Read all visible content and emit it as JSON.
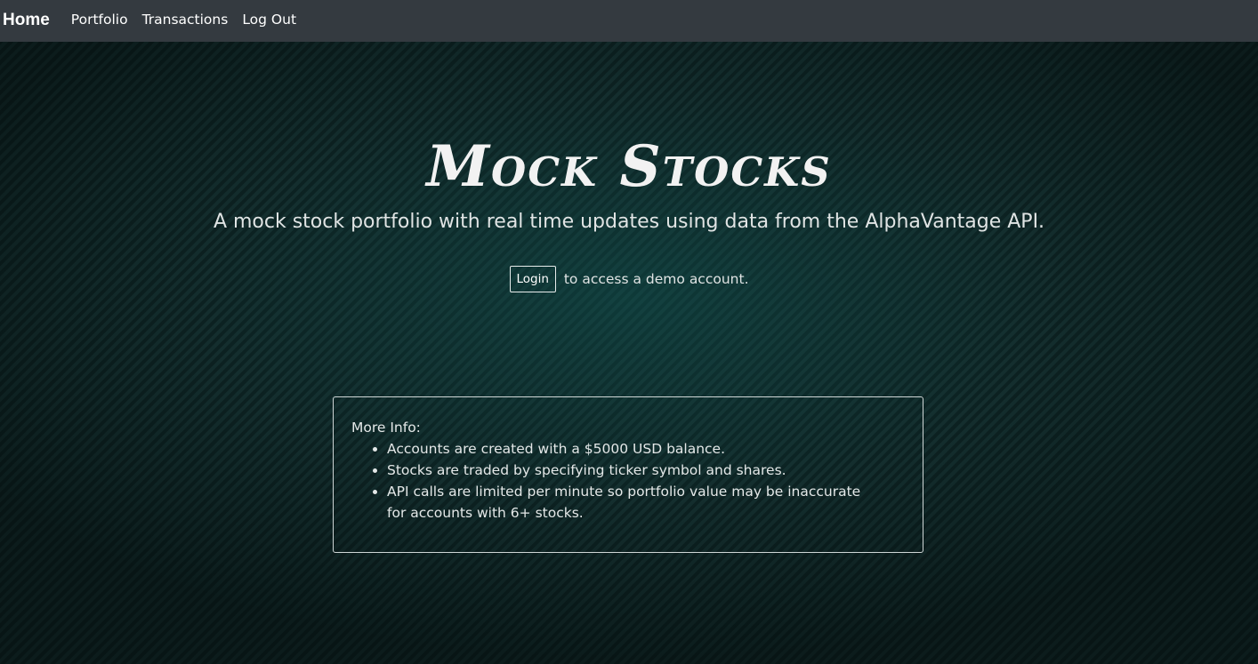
{
  "navbar": {
    "brand": "Home",
    "links": [
      "Portfolio",
      "Transactions",
      "Log Out"
    ]
  },
  "hero": {
    "title": "Mock Stocks",
    "subtitle": "A mock stock portfolio with real time updates using data from the AlphaVantage API.",
    "login_button": "Login",
    "login_text": "to access a demo account."
  },
  "info": {
    "title": "More Info:",
    "items": [
      "Accounts are created with a $5000 USD balance.",
      "Stocks are traded by specifying ticker symbol and shares.",
      "API calls are limited per minute so portfolio value may be inaccurate for accounts with 6+ stocks."
    ]
  },
  "colors": {
    "navbar": "#343a40",
    "background": "#0f2424",
    "text": "#e8ecec"
  }
}
